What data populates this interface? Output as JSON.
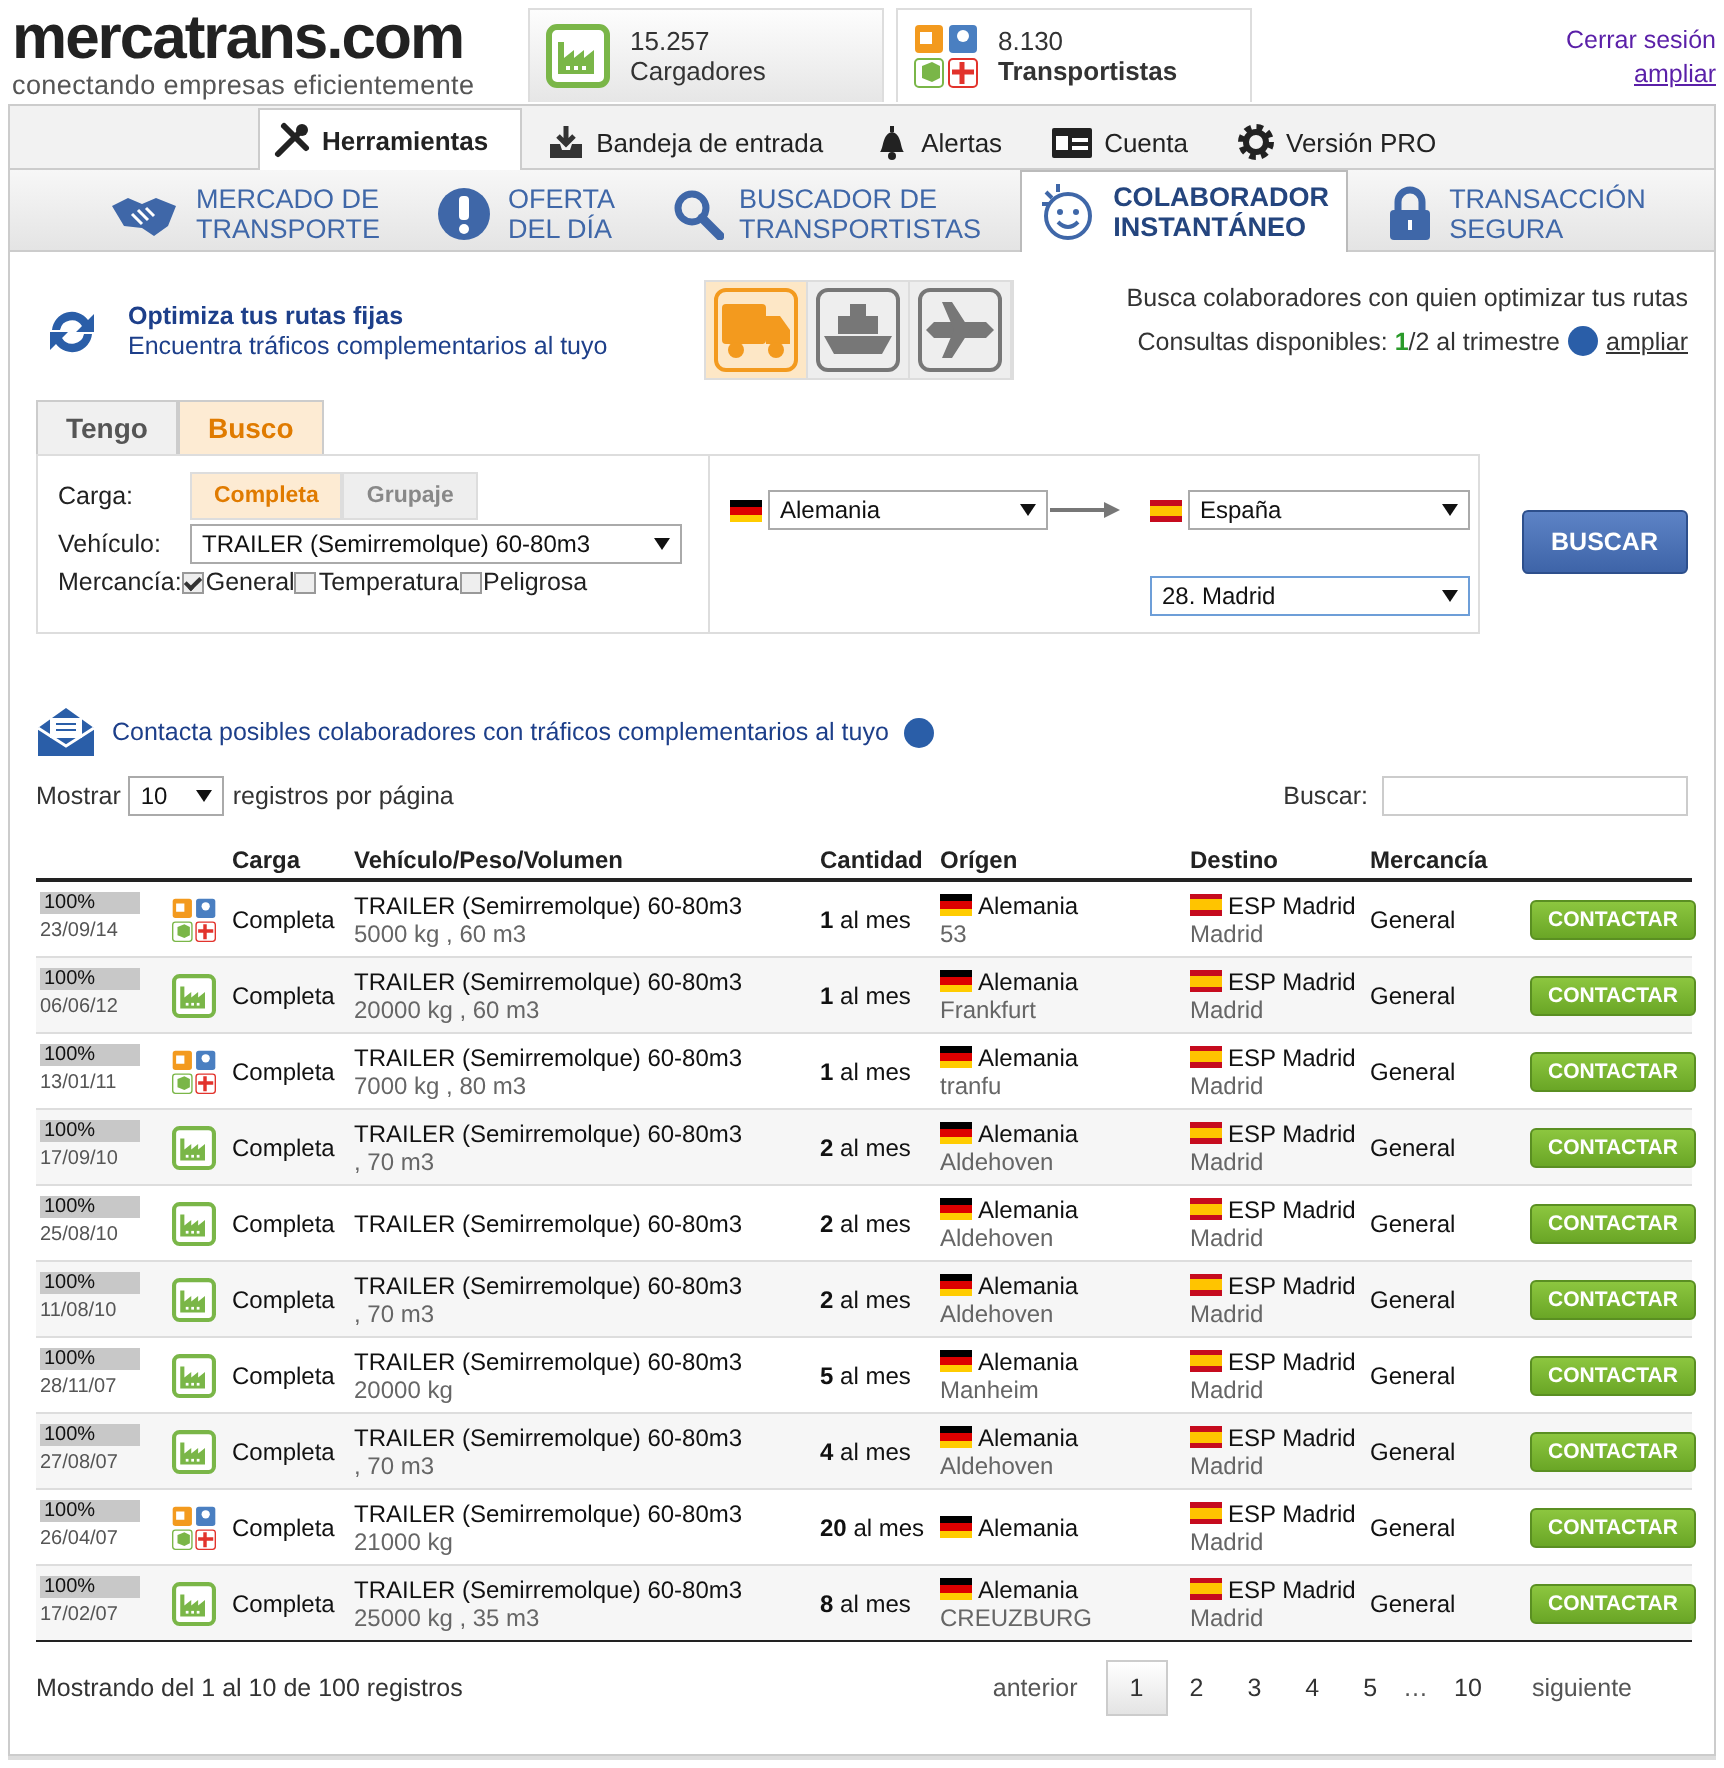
{
  "header": {
    "logo": "mercatrans.com",
    "tagline": "conectando empresas eficientemente",
    "stats": [
      {
        "count": "15.257",
        "label": "Cargadores",
        "kind": "shipper",
        "selected": false
      },
      {
        "count": "8.130",
        "label": "Transportistas",
        "kind": "carrier",
        "selected": true
      }
    ],
    "account": {
      "logout": "Cerrar sesión",
      "more": "ampliar"
    }
  },
  "nav": {
    "main_tabs": [
      {
        "label": "Herramientas",
        "selected": true
      },
      {
        "label": "Bandeja de entrada",
        "selected": false
      },
      {
        "label": "Alertas",
        "selected": false
      },
      {
        "label": "Cuenta",
        "selected": false
      },
      {
        "label": "Versión PRO",
        "selected": false
      }
    ],
    "sub_tabs": [
      {
        "lines": [
          "MERCADO DE",
          "TRANSPORTE"
        ],
        "selected": false
      },
      {
        "lines": [
          "OFERTA",
          "DEL DÍA"
        ],
        "selected": false
      },
      {
        "lines": [
          "BUSCADOR DE",
          "TRANSPORTISTAS"
        ],
        "selected": false
      },
      {
        "lines": [
          "COLABORADOR",
          "INSTANTÁNEO"
        ],
        "selected": true
      },
      {
        "lines": [
          "TRANSACCIÓN",
          "SEGURA"
        ],
        "selected": false
      }
    ]
  },
  "optimize": {
    "title": "Optimiza tus rutas fijas",
    "subtitle": "Encuentra tráficos complementarios al tuyo",
    "modes": [
      {
        "kind": "truck",
        "selected": true
      },
      {
        "kind": "ship",
        "selected": false
      },
      {
        "kind": "plane",
        "selected": false
      }
    ],
    "note": "Busca colaboradores con quien optimizar tus rutas",
    "quota": "Consultas disponibles: **1**/2 al trimestre",
    "quota_link": "ampliar"
  },
  "form": {
    "tabs": [
      {
        "label": "Tengo",
        "selected": false
      },
      {
        "label": "Busco",
        "selected": true
      }
    ],
    "load_label": "Carga:",
    "load_options": [
      {
        "label": "Completa",
        "selected": true
      },
      {
        "label": "Grupaje",
        "selected": false
      }
    ],
    "vehicle_label": "Vehículo:",
    "vehicle": "TRAILER (Semirremolque) 60-80m3",
    "goods_label": "Mercancía:",
    "goods": [
      {
        "label": "General",
        "checked": true
      },
      {
        "label": "Temperatura",
        "checked": false
      },
      {
        "label": "Peligrosa",
        "checked": false
      }
    ],
    "origin": {
      "country": "Alemania"
    },
    "destination": {
      "country": "España",
      "region": "28. Madrid"
    },
    "submit": "BUSCAR"
  },
  "results": {
    "heading": "Contacta posibles colaboradores con tráficos complementarios al tuyo",
    "show_label": "Mostrar",
    "page_size": "10",
    "per_page": "registros por página",
    "search_label": "Buscar:",
    "columns": [
      "Carga",
      "Vehículo/Peso/Volumen",
      "Cantidad",
      "Orígen",
      "Destino",
      "Mercancía"
    ],
    "rows": [
      {
        "percent": "100%",
        "level": 1,
        "date": "23/09/14",
        "kind": "carrier",
        "load": "Completa",
        "vehicle": "TRAILER (Semirremolque) 60-80m3",
        "detail": "5000 kg , 60 m3",
        "quantity": "**1** al mes",
        "origin": {
          "country": "Alemania",
          "city": "53"
        },
        "destination": {
          "place": "ESP Madrid",
          "city": "Madrid"
        },
        "goods": "General",
        "action": "CONTACTAR"
      },
      {
        "percent": "100%",
        "level": 1,
        "date": "06/06/12",
        "kind": "shipper",
        "load": "Completa",
        "vehicle": "TRAILER (Semirremolque) 60-80m3",
        "detail": "20000 kg , 60 m3",
        "quantity": "**1** al mes",
        "origin": {
          "country": "Alemania",
          "city": "Frankfurt"
        },
        "destination": {
          "place": "ESP Madrid",
          "city": "Madrid"
        },
        "goods": "General",
        "action": "CONTACTAR"
      },
      {
        "percent": "100%",
        "level": 1,
        "date": "13/01/11",
        "kind": "carrier",
        "load": "Completa",
        "vehicle": "TRAILER (Semirremolque) 60-80m3",
        "detail": "7000 kg , 80 m3",
        "quantity": "**1** al mes",
        "origin": {
          "country": "Alemania",
          "city": "tranfu"
        },
        "destination": {
          "place": "ESP Madrid",
          "city": "Madrid"
        },
        "goods": "General",
        "action": "CONTACTAR"
      },
      {
        "percent": "100%",
        "level": 1,
        "date": "17/09/10",
        "kind": "shipper",
        "load": "Completa",
        "vehicle": "TRAILER (Semirremolque) 60-80m3",
        "detail": ", 70 m3",
        "quantity": "**2** al mes",
        "origin": {
          "country": "Alemania",
          "city": "Aldehoven"
        },
        "destination": {
          "place": "ESP Madrid",
          "city": "Madrid"
        },
        "goods": "General",
        "action": "CONTACTAR"
      },
      {
        "percent": "100%",
        "level": 1,
        "date": "25/08/10",
        "kind": "shipper",
        "load": "Completa",
        "vehicle": "TRAILER (Semirremolque) 60-80m3",
        "quantity": "**2** al mes",
        "origin": {
          "country": "Alemania",
          "city": "Aldehoven"
        },
        "destination": {
          "place": "ESP Madrid",
          "city": "Madrid"
        },
        "goods": "General",
        "action": "CONTACTAR"
      },
      {
        "percent": "100%",
        "level": 1,
        "date": "11/08/10",
        "kind": "shipper",
        "load": "Completa",
        "vehicle": "TRAILER (Semirremolque) 60-80m3",
        "detail": ", 70 m3",
        "quantity": "**2** al mes",
        "origin": {
          "country": "Alemania",
          "city": "Aldehoven"
        },
        "destination": {
          "place": "ESP Madrid",
          "city": "Madrid"
        },
        "goods": "General",
        "action": "CONTACTAR"
      },
      {
        "percent": "100%",
        "level": 1,
        "date": "28/11/07",
        "kind": "shipper",
        "load": "Completa",
        "vehicle": "TRAILER (Semirremolque) 60-80m3",
        "detail": "20000 kg",
        "quantity": "**5** al mes",
        "origin": {
          "country": "Alemania",
          "city": "Manheim"
        },
        "destination": {
          "place": "ESP Madrid",
          "city": "Madrid"
        },
        "goods": "General",
        "action": "CONTACTAR"
      },
      {
        "percent": "100%",
        "level": 1,
        "date": "27/08/07",
        "kind": "shipper",
        "load": "Completa",
        "vehicle": "TRAILER (Semirremolque) 60-80m3",
        "detail": ", 70 m3",
        "quantity": "**4** al mes",
        "origin": {
          "country": "Alemania",
          "city": "Aldehoven"
        },
        "destination": {
          "place": "ESP Madrid",
          "city": "Madrid"
        },
        "goods": "General",
        "action": "CONTACTAR"
      },
      {
        "percent": "100%",
        "level": 1,
        "date": "26/04/07",
        "kind": "carrier",
        "load": "Completa",
        "vehicle": "TRAILER (Semirremolque) 60-80m3",
        "detail": "21000 kg",
        "quantity": "**20** al mes",
        "origin": {
          "country": "Alemania"
        },
        "destination": {
          "place": "ESP Madrid",
          "city": "Madrid"
        },
        "goods": "General",
        "action": "CONTACTAR"
      },
      {
        "percent": "100%",
        "level": 1,
        "date": "17/02/07",
        "kind": "shipper",
        "load": "Completa",
        "vehicle": "TRAILER (Semirremolque) 60-80m3",
        "detail": "25000 kg , 35 m3",
        "quantity": "**8** al mes",
        "origin": {
          "country": "Alemania",
          "city": "CREUZBURG"
        },
        "destination": {
          "place": "ESP Madrid",
          "city": "Madrid"
        },
        "goods": "General",
        "action": "CONTACTAR"
      }
    ],
    "summary": "Mostrando del 1 al 10 de 100 registros",
    "pagination": {
      "previous": "anterior",
      "next": "siguiente",
      "pages": [
        {
          "kind": "page",
          "label": "1",
          "selected": true
        },
        {
          "kind": "page",
          "label": "2",
          "selected": false
        },
        {
          "kind": "page",
          "label": "3",
          "selected": false
        },
        {
          "kind": "page",
          "label": "4",
          "selected": false
        },
        {
          "kind": "page",
          "label": "5",
          "selected": false
        },
        {
          "kind": "gap",
          "label": "…"
        },
        {
          "kind": "page",
          "label": "10",
          "selected": false
        }
      ]
    }
  }
}
